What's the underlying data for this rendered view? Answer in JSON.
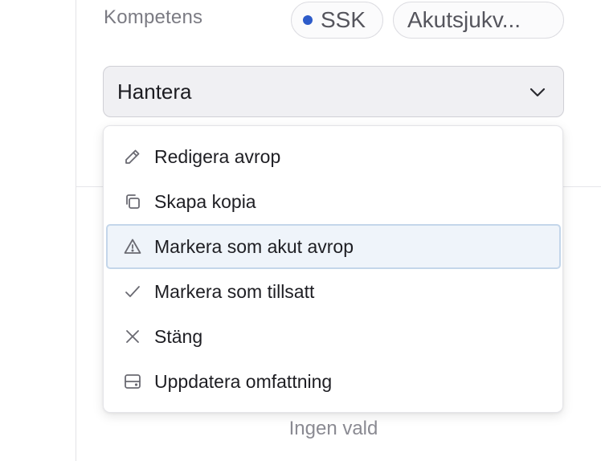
{
  "competence": {
    "label": "Kompetens",
    "chips": [
      {
        "label": "SSK",
        "dot_color": "#2d5bc9"
      },
      {
        "label": "Akutsjukv..."
      }
    ]
  },
  "manage_select": {
    "label": "Hantera",
    "icon": "chevron-down-icon"
  },
  "menu": {
    "items": [
      {
        "label": "Redigera avrop",
        "icon": "pencil-icon"
      },
      {
        "label": "Skapa kopia",
        "icon": "copy-icon"
      },
      {
        "label": "Markera som akut avrop",
        "icon": "warning-triangle-icon",
        "highlighted": true
      },
      {
        "label": "Markera som tillsatt",
        "icon": "check-icon"
      },
      {
        "label": "Stäng",
        "icon": "close-icon"
      },
      {
        "label": "Uppdatera omfattning",
        "icon": "server-icon"
      }
    ]
  },
  "footer": {
    "empty_text": "Ingen vald"
  },
  "colors": {
    "accent_dot": "#2d5bc9",
    "highlight_bg": "#eff4fa",
    "highlight_border": "#c4d6ea"
  }
}
